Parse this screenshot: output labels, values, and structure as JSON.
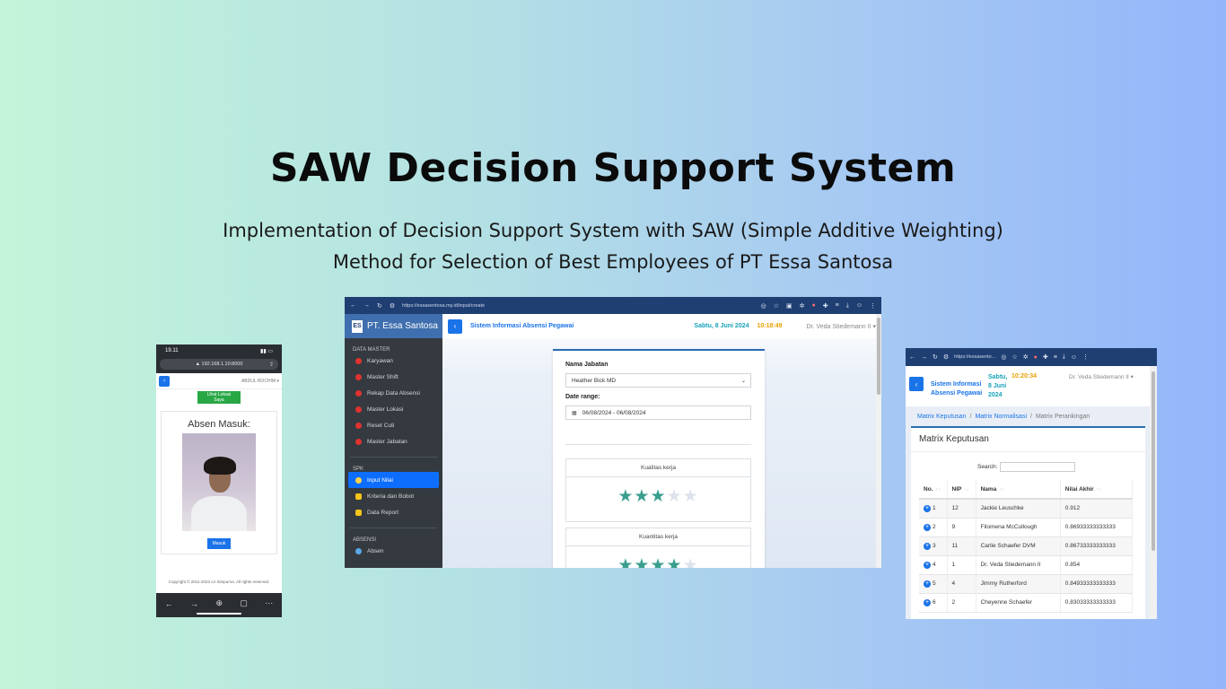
{
  "hero": {
    "title": "SAW Decision Support System",
    "subtitle_line1": "Implementation of Decision Support System with SAW (Simple Additive Weighting)",
    "subtitle_line2": "Method for Selection of Best Employees of PT Essa Santosa"
  },
  "phone": {
    "time": "19.11",
    "url": "▲ 192.168.1.10:8000",
    "user": "ABDUL ROCHIM ▾",
    "location_button": "Lihat Lokasi Saya",
    "card_title": "Absen Masuk:",
    "submit_button": "Masuk",
    "footer": "Copyright © 2011-2023 AJ Simpurna. All rights reserved."
  },
  "browser1": {
    "url": "https://essasentosa.my.id/input/create",
    "brand": "PT. Essa Santosa",
    "sidebar": {
      "section_master": "DATA MASTER",
      "master_items": [
        "Karyawan",
        "Master Shift",
        "Rekap Data Absensi",
        "Master Lokasi",
        "Reset Cuti",
        "Master Jabatan"
      ],
      "section_spk": "SPK",
      "spk_items": [
        "Input Nilai",
        "Kriteria dan Bobot",
        "Data Report"
      ],
      "section_absensi": "ABSENSI",
      "absensi_items": [
        "Absen"
      ]
    },
    "app_title": "Sistem Informasi Absensi Pegawai",
    "date": "Sabtu, 8 Juni 2024",
    "time": "10:18:49",
    "user": "Dr. Veda Stiedemann II ▾",
    "form": {
      "jabatan_label": "Nama Jabatan",
      "jabatan_value": "Heather Bick MD",
      "date_label": "Date range:",
      "date_value": "06/08/2024 - 06/08/2024",
      "criteria": [
        {
          "name": "Kualitas kerja",
          "rating": 3,
          "max": 5
        },
        {
          "name": "Kuantitas kerja",
          "rating": 4,
          "max": 5
        }
      ]
    }
  },
  "browser2": {
    "url": "https://essasento...",
    "app_title_line1": "Sistem Informasi",
    "app_title_line2": "Absensi Pegawai",
    "date_line1": "Sabtu,",
    "date_line2": "8 Juni",
    "date_line3": "2024",
    "time": "10:20:34",
    "user": "Dr. Veda Stiedemann II ▾",
    "breadcrumb": [
      "Matrix Keputusan",
      "Matrix Normalisasi",
      "Matrix Perankingan"
    ],
    "card_title": "Matrix Keputusan",
    "search_label": "Search:",
    "columns": [
      "No.",
      "NIP",
      "Nama",
      "Nilai Akhir"
    ],
    "rows": [
      [
        "1",
        "12",
        "Jackie Leuschke",
        "0.912"
      ],
      [
        "2",
        "9",
        "Filomena McCullough",
        "0.86933333333333"
      ],
      [
        "3",
        "11",
        "Carlie Schaefer DVM",
        "0.86733333333333"
      ],
      [
        "4",
        "1",
        "Dr. Veda Stiedemann II",
        "0.854"
      ],
      [
        "5",
        "4",
        "Jimmy Rutherford",
        "0.84933333333333"
      ],
      [
        "6",
        "2",
        "Cheyenne Schaefer",
        "0.83033333333333"
      ]
    ]
  }
}
